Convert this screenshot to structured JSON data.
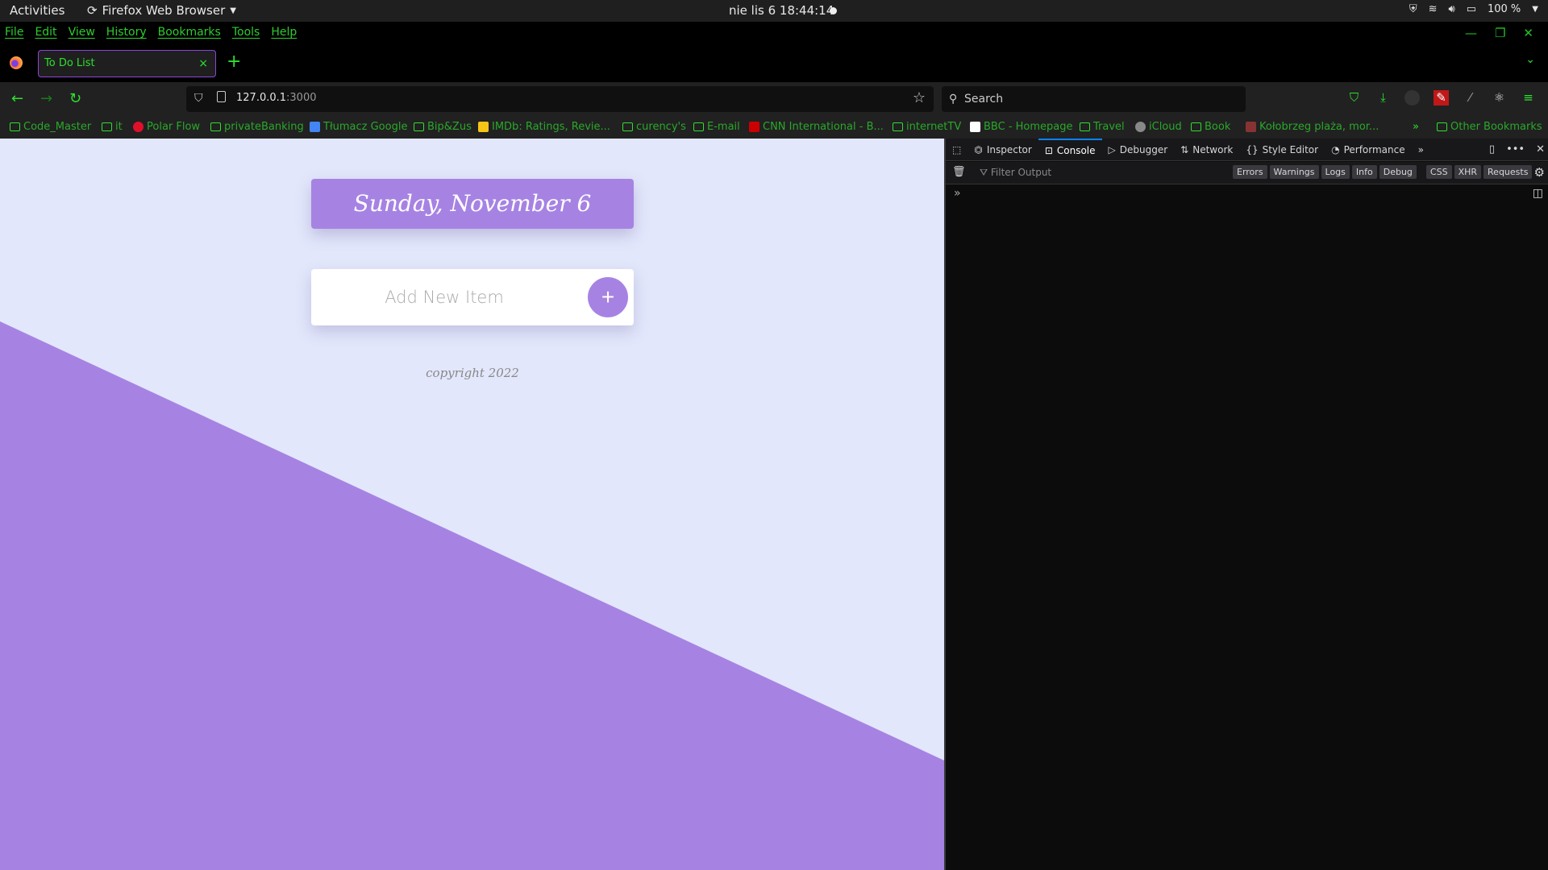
{
  "system_bar": {
    "activities": "Activities",
    "app_name": "Firefox Web Browser",
    "clock": "nie lis 6  18:44:14",
    "battery": "100 %"
  },
  "menu": [
    "File",
    "Edit",
    "View",
    "History",
    "Bookmarks",
    "Tools",
    "Help"
  ],
  "tab": {
    "title": "To Do List",
    "close": "×",
    "new_tab": "+"
  },
  "navigation": {
    "url_host": "127.0.0.1",
    "url_port": ":3000",
    "search_placeholder": "Search"
  },
  "bookmarks": [
    {
      "label": "Code_Master",
      "icon": "folder"
    },
    {
      "label": "it",
      "icon": "folder"
    },
    {
      "label": "Polar Flow",
      "icon": "polar"
    },
    {
      "label": "privateBanking",
      "icon": "folder"
    },
    {
      "label": "Tłumacz Google",
      "icon": "google-translate"
    },
    {
      "label": "Bip&Zus",
      "icon": "folder"
    },
    {
      "label": "IMDb: Ratings, Revie...",
      "icon": "imdb"
    },
    {
      "label": "curency's",
      "icon": "folder"
    },
    {
      "label": "E-mail",
      "icon": "folder"
    },
    {
      "label": "CNN International - B...",
      "icon": "cnn"
    },
    {
      "label": "internetTV",
      "icon": "folder"
    },
    {
      "label": "BBC - Homepage",
      "icon": "bbc"
    },
    {
      "label": "Travel",
      "icon": "folder"
    },
    {
      "label": "iCloud",
      "icon": "apple"
    },
    {
      "label": "Book",
      "icon": "folder"
    },
    {
      "label": "Kołobrzeg plaża, mor...",
      "icon": "site"
    }
  ],
  "other_bookmarks": "Other Bookmarks",
  "page": {
    "date_header": "Sunday, November 6",
    "input_placeholder": "Add New Item",
    "add_button": "+",
    "footer": "copyright 2022",
    "colors": {
      "accent": "#a683e3",
      "background": "#e2e7fb"
    }
  },
  "devtools": {
    "tabs": [
      "Inspector",
      "Console",
      "Debugger",
      "Network",
      "Style Editor",
      "Performance"
    ],
    "active_tab": "Console",
    "filter_placeholder": "Filter Output",
    "filters": [
      "Errors",
      "Warnings",
      "Logs",
      "Info",
      "Debug"
    ],
    "filters2": [
      "CSS",
      "XHR",
      "Requests"
    ],
    "prompt": "»"
  }
}
